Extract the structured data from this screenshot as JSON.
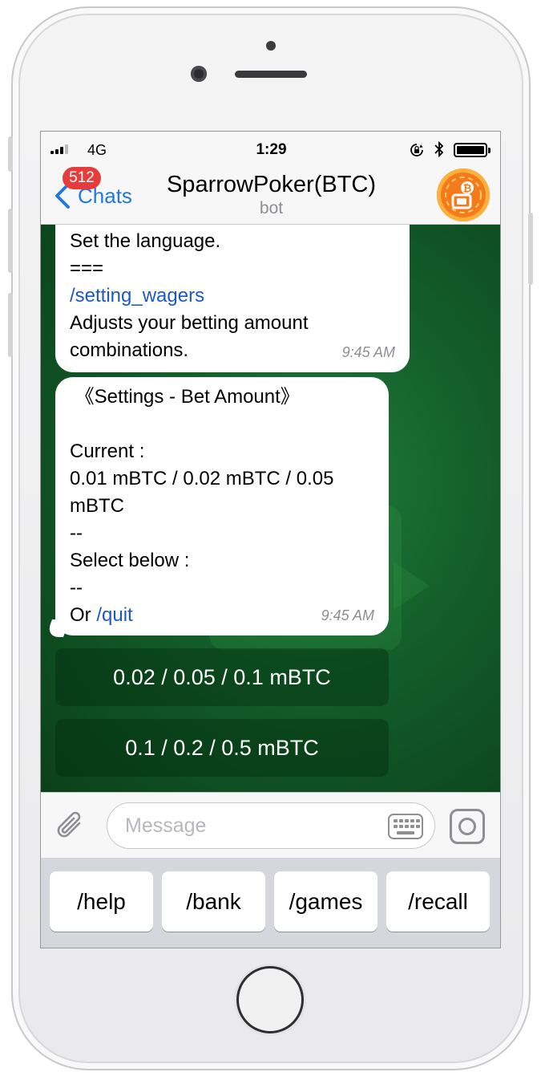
{
  "status_bar": {
    "carrier": "4G",
    "time": "1:29"
  },
  "nav": {
    "back_label": "Chats",
    "unread_badge": "512",
    "title": "SparrowPoker(BTC)",
    "subtitle": "bot"
  },
  "messages": [
    {
      "lines": [
        {
          "text": "Set the language.",
          "link": false
        },
        {
          "text": "===",
          "link": false
        },
        {
          "text": "/setting_wagers",
          "link": true
        },
        {
          "text": "Adjusts your betting amount",
          "link": false
        },
        {
          "text": "combinations.",
          "link": false
        }
      ],
      "time": "9:45 AM"
    },
    {
      "lines": [
        {
          "text": " 《Settings - Bet Amount》",
          "link": false
        },
        {
          "text": "",
          "link": false
        },
        {
          "text": "Current :",
          "link": false
        },
        {
          "text": "0.01 mBTC / 0.02 mBTC / 0.05",
          "link": false
        },
        {
          "text": "mBTC",
          "link": false
        },
        {
          "text": "--",
          "link": false
        },
        {
          "text": "Select below :",
          "link": false
        },
        {
          "text": "--",
          "link": false
        }
      ],
      "last_prefix": "Or ",
      "last_link": "/quit",
      "time": "9:45 AM"
    }
  ],
  "inline_buttons": [
    "0.02 / 0.05 / 0.1 mBTC",
    "0.1 / 0.2 / 0.5 mBTC"
  ],
  "input": {
    "placeholder": "Message"
  },
  "reply_keyboard": [
    "/help",
    "/bank",
    "/games",
    "/recall"
  ],
  "colors": {
    "accent": "#1f7ae0",
    "badge": "#e63c3c",
    "chat_background": "#135d2a",
    "link": "#1b59c4"
  },
  "icons": {
    "back": "chevron-left-icon",
    "attach": "paperclip-icon",
    "keyboard": "keyboard-icon",
    "camera": "camera-icon",
    "lock": "rotation-lock-icon",
    "bluetooth": "bluetooth-icon",
    "battery": "battery-icon"
  }
}
